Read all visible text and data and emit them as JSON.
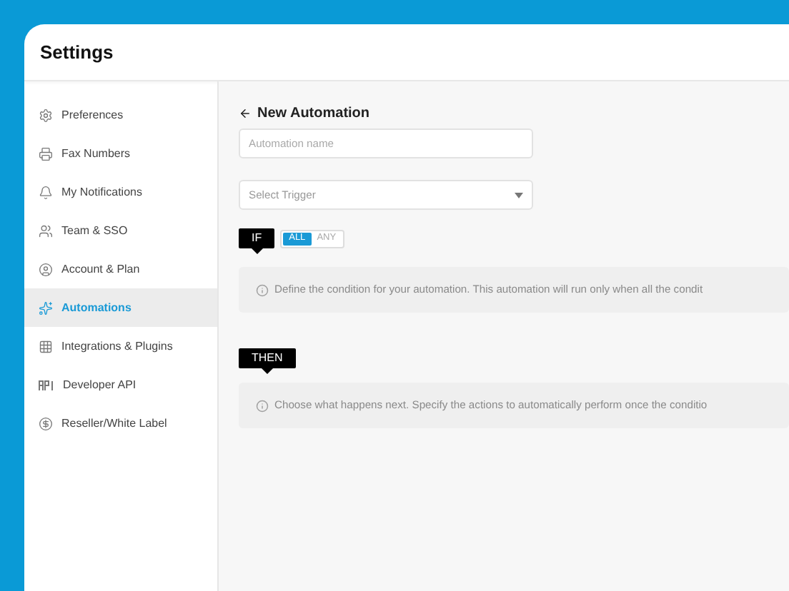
{
  "header": {
    "title": "Settings"
  },
  "sidebar": {
    "items": [
      {
        "label": "Preferences",
        "selected": false
      },
      {
        "label": "Fax Numbers",
        "selected": false
      },
      {
        "label": "My Notifications",
        "selected": false
      },
      {
        "label": "Team & SSO",
        "selected": false
      },
      {
        "label": "Account & Plan",
        "selected": false
      },
      {
        "label": "Automations",
        "selected": true
      },
      {
        "label": "Integrations & Plugins",
        "selected": false
      },
      {
        "label": "Developer API",
        "selected": false
      },
      {
        "label": "Reseller/White Label",
        "selected": false
      }
    ]
  },
  "page": {
    "title": "New Automation",
    "name_field": {
      "placeholder": "Automation name"
    },
    "trigger_select": {
      "placeholder": "Select Trigger"
    },
    "if_section": {
      "tag": "IF",
      "match_options": [
        {
          "label": "ALL",
          "selected": true
        },
        {
          "label": "ANY",
          "selected": false
        }
      ],
      "info": "Define the condition for your automation. This automation will run only when all the condit"
    },
    "then_section": {
      "tag": "THEN",
      "info": "Choose what happens next. Specify the actions to automatically perform once the conditio"
    }
  }
}
